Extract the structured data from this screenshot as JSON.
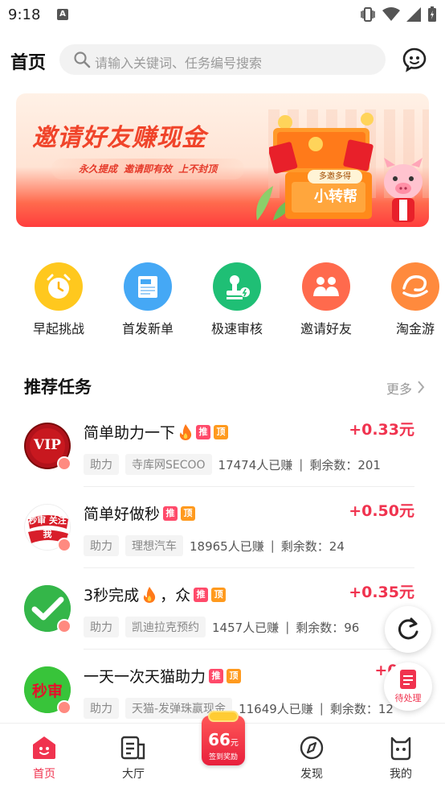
{
  "status_bar": {
    "time": "9:18",
    "notification": "A"
  },
  "header": {
    "title": "首页",
    "search_placeholder": "请输入关键词、任务编号搜索"
  },
  "banner": {
    "headline": "邀请好友赚现金",
    "subline": "永久提成  邀请即有效  上不封顶",
    "chest_label_top": "多邀多得",
    "chest_label": "小转帮"
  },
  "quick_entries": [
    {
      "label": "早起挑战",
      "icon": "alarm-clock-icon",
      "color": "#ffc81e"
    },
    {
      "label": "首发新单",
      "icon": "new-document-icon",
      "color": "#45a8f5"
    },
    {
      "label": "极速审核",
      "icon": "stamp-icon",
      "color": "#1fbf75"
    },
    {
      "label": "邀请好友",
      "icon": "people-icon",
      "color": "#ff6a4d"
    },
    {
      "label": "淘金游",
      "icon": "gold-icon",
      "color": "#ff8a3d"
    }
  ],
  "section": {
    "title": "推荐任务",
    "more": "更多"
  },
  "tasks": [
    {
      "name": "简单助力一下",
      "fire": true,
      "tags": [
        "推",
        "顶"
      ],
      "reward": "+0.33元",
      "type": "助力",
      "source": "寺库网SECOO",
      "earned": "17474人已赚",
      "remaining": "剩余数：201",
      "avatar_text": "VIP"
    },
    {
      "name": "简单好做秒",
      "fire": false,
      "tags": [
        "推",
        "顶"
      ],
      "reward": "+0.50元",
      "type": "助力",
      "source": "理想汽车",
      "earned": "18965人已赚",
      "remaining": "剩余数：24",
      "avatar_text": "秒审 关注我"
    },
    {
      "name": "3秒完成",
      "name_suffix": "，众",
      "fire": true,
      "tags": [
        "推",
        "顶"
      ],
      "reward": "+0.35元",
      "type": "助力",
      "source": "凯迪拉克预约",
      "earned": "1457人已赚",
      "remaining": "剩余数：96",
      "avatar_text": ""
    },
    {
      "name": "一天一次天猫助力",
      "fire": false,
      "tags": [
        "推",
        "顶"
      ],
      "reward": "+0.4",
      "type": "助力",
      "source": "天猫-发弹珠赢现金",
      "earned": "11649人已赚",
      "remaining": "剩余数：12",
      "avatar_text": "秒审"
    }
  ],
  "fab": {
    "pending_label": "待处理"
  },
  "bottom_nav": [
    {
      "label": "首页",
      "active": true
    },
    {
      "label": "大厅",
      "active": false
    },
    {
      "label": "发现",
      "active": false
    },
    {
      "label": "我的",
      "active": false
    }
  ],
  "center_reward": {
    "amount": "66",
    "unit": "元",
    "label": "签到奖励"
  },
  "colors": {
    "accent": "#f0334f",
    "tag_tui": "#ff4a6a",
    "tag_ding": "#ff9a1e"
  }
}
